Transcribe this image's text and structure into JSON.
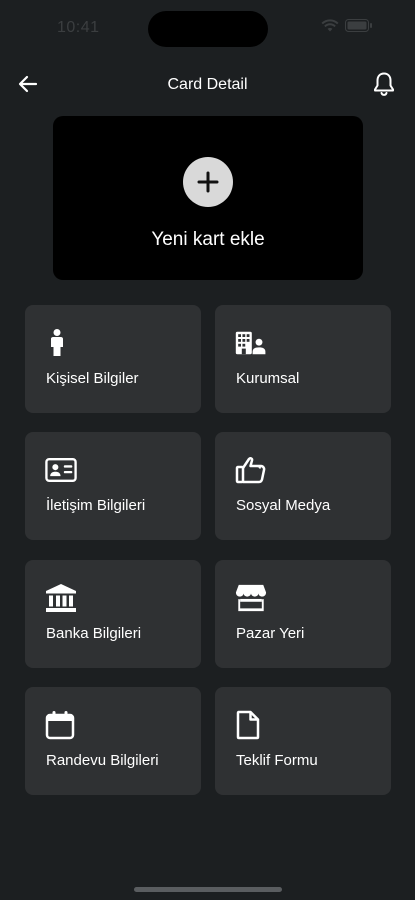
{
  "status_bar": {
    "time": "10:41"
  },
  "header": {
    "title": "Card Detail"
  },
  "add_card": {
    "label": "Yeni kart ekle"
  },
  "tiles": [
    {
      "label": "Kişisel Bilgiler",
      "icon": "person-icon"
    },
    {
      "label": "Kurumsal",
      "icon": "building-icon"
    },
    {
      "label": "İletişim Bilgileri",
      "icon": "contact-card-icon"
    },
    {
      "label": "Sosyal Medya",
      "icon": "thumbs-up-icon"
    },
    {
      "label": "Banka Bilgileri",
      "icon": "bank-icon"
    },
    {
      "label": "Pazar Yeri",
      "icon": "store-icon"
    },
    {
      "label": "Randevu Bilgileri",
      "icon": "calendar-icon"
    },
    {
      "label": "Teklif Formu",
      "icon": "document-icon"
    }
  ],
  "colors": {
    "background": "#1c1f21",
    "tile": "#2f3133",
    "card": "#000000",
    "text": "#ffffff"
  }
}
